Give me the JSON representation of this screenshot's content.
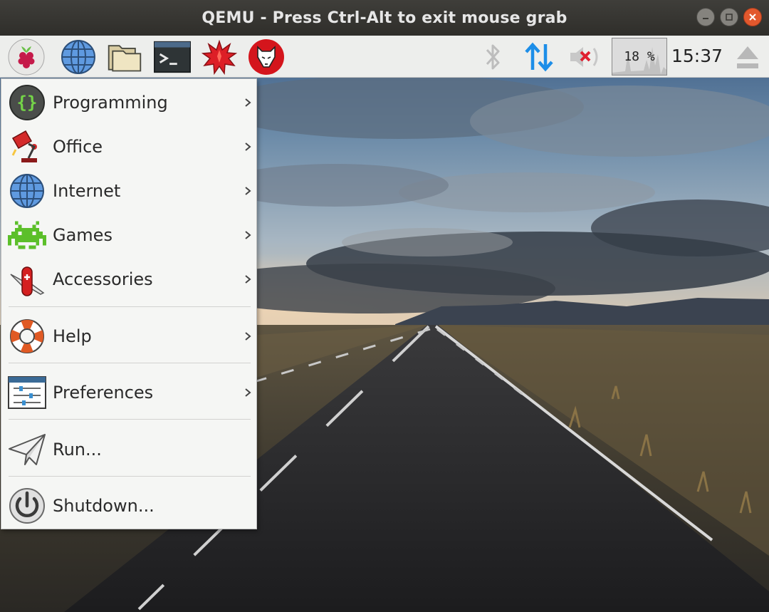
{
  "window": {
    "title": "QEMU - Press Ctrl-Alt to exit mouse grab",
    "buttons": [
      "minimize-icon",
      "maximize-icon",
      "close-icon"
    ]
  },
  "panel": {
    "launchers": [
      {
        "name": "raspberry-menu-button",
        "icon": "raspberry-icon"
      },
      {
        "name": "web-browser-launcher",
        "icon": "globe-icon"
      },
      {
        "name": "file-manager-launcher",
        "icon": "folder-icon"
      },
      {
        "name": "terminal-launcher",
        "icon": "terminal-icon"
      },
      {
        "name": "mathematica-launcher",
        "icon": "mathematica-icon"
      },
      {
        "name": "wolfram-launcher",
        "icon": "wolfram-icon"
      }
    ],
    "tray": {
      "bluetooth_icon": "bluetooth-icon",
      "network_icon": "network-updown-icon",
      "volume_icon": "volume-muted-icon",
      "cpu_usage": "18 %",
      "cpu_fraction": 0.18,
      "clock": "15:37",
      "eject_icon": "eject-icon"
    }
  },
  "menu": {
    "items": [
      {
        "label": "Programming",
        "icon": "programming-icon",
        "submenu": true
      },
      {
        "label": "Office",
        "icon": "office-lamp-icon",
        "submenu": true
      },
      {
        "label": "Internet",
        "icon": "globe-icon",
        "submenu": true
      },
      {
        "label": "Games",
        "icon": "space-invader-icon",
        "submenu": true
      },
      {
        "label": "Accessories",
        "icon": "pocket-knife-icon",
        "submenu": true
      },
      {
        "label": "Help",
        "icon": "lifebuoy-icon",
        "submenu": true
      },
      {
        "label": "Preferences",
        "icon": "preferences-icon",
        "submenu": true
      },
      {
        "label": "Run...",
        "icon": "paper-plane-icon",
        "submenu": false
      },
      {
        "label": "Shutdown...",
        "icon": "power-icon",
        "submenu": false
      }
    ]
  },
  "colors": {
    "titlebar": "#3a3935",
    "close_button": "#e2582d",
    "panel": "#edeeec",
    "menu_background": "#f5f6f4",
    "network_arrows": "#1d8ee8"
  }
}
